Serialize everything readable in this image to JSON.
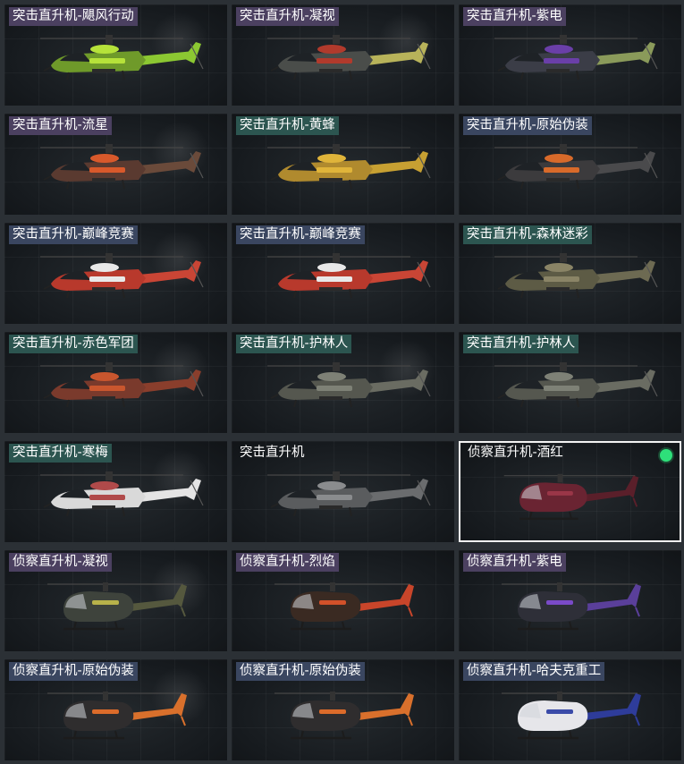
{
  "skins": [
    {
      "label": "突击直升机-飓风行动",
      "type": "attack",
      "tag": "purple",
      "body": "#6f9a2a",
      "accent": "#b6e23a",
      "tail": "#8cc832"
    },
    {
      "label": "突击直升机-凝视",
      "type": "attack",
      "tag": "purple",
      "body": "#4a4d4a",
      "accent": "#b13a2c",
      "tail": "#b8b35a"
    },
    {
      "label": "突击直升机-紫电",
      "type": "attack",
      "tag": "purple",
      "body": "#3b3d47",
      "accent": "#6a3fa8",
      "tail": "#8a9a5a"
    },
    {
      "label": "突击直升机-流星",
      "type": "attack",
      "tag": "purple",
      "body": "#5a3a30",
      "accent": "#d8592b",
      "tail": "#6a4a3a"
    },
    {
      "label": "突击直升机-黄蜂",
      "type": "attack",
      "tag": "teal",
      "body": "#b08a2e",
      "accent": "#e0b43a",
      "tail": "#c7a032"
    },
    {
      "label": "突击直升机-原始伪装",
      "type": "attack",
      "tag": "blue",
      "body": "#3c3b3d",
      "accent": "#d86a2a",
      "tail": "#4a4a4c"
    },
    {
      "label": "突击直升机-巅峰竞赛",
      "type": "attack",
      "tag": "blue",
      "body": "#b8392c",
      "accent": "#e8e8e8",
      "tail": "#c94535"
    },
    {
      "label": "突击直升机-巅峰竞赛",
      "type": "attack",
      "tag": "blue",
      "body": "#b8392c",
      "accent": "#e8e8e8",
      "tail": "#c94535"
    },
    {
      "label": "突击直升机-森林迷彩",
      "type": "attack",
      "tag": "teal",
      "body": "#5d5b45",
      "accent": "#8a8466",
      "tail": "#6d6a52"
    },
    {
      "label": "突击直升机-赤色军团",
      "type": "attack",
      "tag": "teal",
      "body": "#7a3a2c",
      "accent": "#c9562e",
      "tail": "#8a3e2c"
    },
    {
      "label": "突击直升机-护林人",
      "type": "attack",
      "tag": "teal",
      "body": "#55574f",
      "accent": "#7e8176",
      "tail": "#6a6c62"
    },
    {
      "label": "突击直升机-护林人",
      "type": "attack",
      "tag": "teal",
      "body": "#55574f",
      "accent": "#7e8176",
      "tail": "#6a6c62"
    },
    {
      "label": "突击直升机-寒梅",
      "type": "attack",
      "tag": "teal",
      "body": "#d9d9d9",
      "accent": "#b04a4a",
      "tail": "#e4e4e4"
    },
    {
      "label": "突击直升机",
      "type": "attack",
      "tag": "none",
      "body": "#5a5c5e",
      "accent": "#8a8c8e",
      "tail": "#6a6c6e"
    },
    {
      "label": "侦察直升机-酒红",
      "type": "recon",
      "tag": "none",
      "selected": true,
      "body": "#6a2432",
      "accent": "#9a3648",
      "tail": "#5a1f2a"
    },
    {
      "label": "侦察直升机-凝视",
      "type": "recon",
      "tag": "purple",
      "body": "#3e433c",
      "accent": "#b8b24a",
      "tail": "#55583e"
    },
    {
      "label": "侦察直升机-烈焰",
      "type": "recon",
      "tag": "purple",
      "body": "#3a2a22",
      "accent": "#d2512a",
      "tail": "#c8452a"
    },
    {
      "label": "侦察直升机-紫电",
      "type": "recon",
      "tag": "purple",
      "body": "#2e2f38",
      "accent": "#7a4ac8",
      "tail": "#5a3f9a"
    },
    {
      "label": "侦察直升机-原始伪装",
      "type": "recon",
      "tag": "blue",
      "body": "#2f2d2e",
      "accent": "#dc6b2a",
      "tail": "#d9702c"
    },
    {
      "label": "侦察直升机-原始伪装",
      "type": "recon",
      "tag": "blue",
      "body": "#2f2d2e",
      "accent": "#dc6b2a",
      "tail": "#d9702c"
    },
    {
      "label": "侦察直升机-哈夫克重工",
      "type": "recon",
      "tag": "blue",
      "body": "#e6e6ea",
      "accent": "#3a4aa8",
      "tail": "#2e3c9a"
    }
  ]
}
